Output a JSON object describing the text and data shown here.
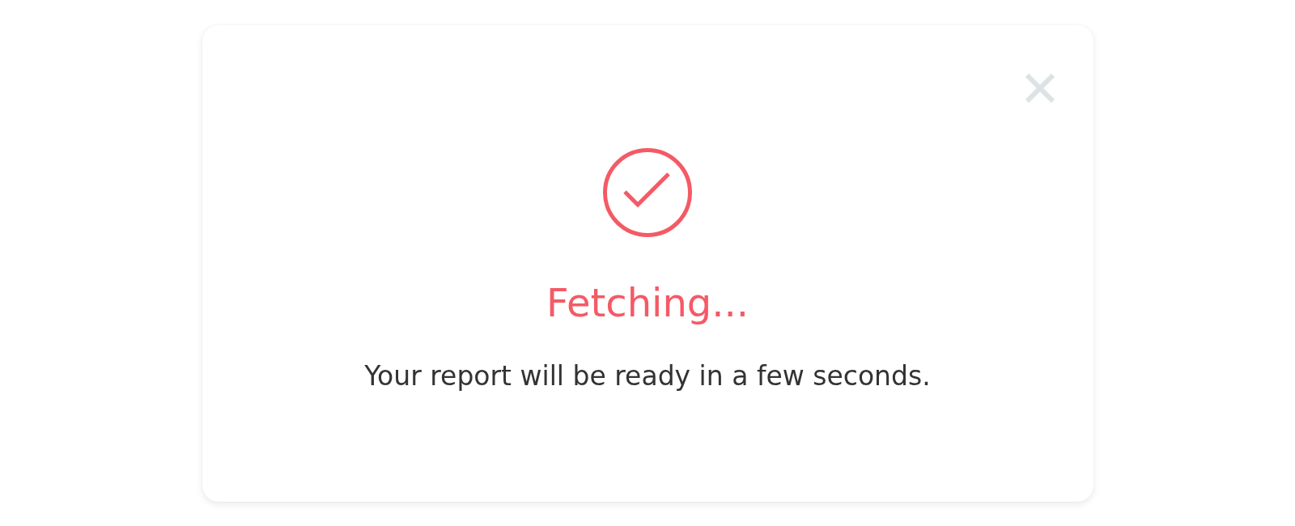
{
  "dialog": {
    "title": "Fetching...",
    "message": "Your report will be ready in a few seconds."
  }
}
